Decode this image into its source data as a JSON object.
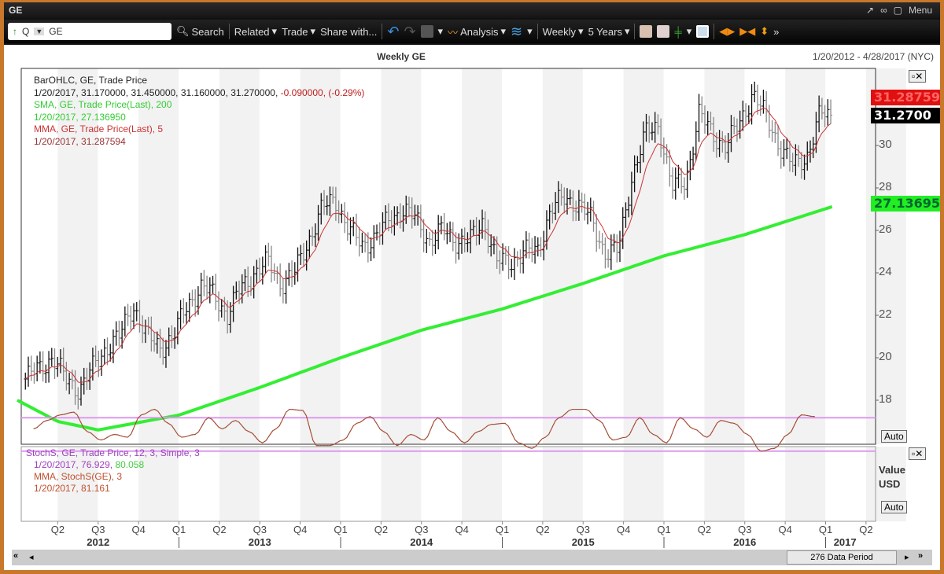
{
  "window": {
    "title": "GE",
    "menu_label": "Menu"
  },
  "toolbar": {
    "symbol_prefix": "Q",
    "symbol": "GE",
    "search": "Search",
    "related": "Related",
    "trade": "Trade",
    "share": "Share with...",
    "analysis": "Analysis",
    "period": "Weekly",
    "range": "5 Years"
  },
  "chart": {
    "title": "Weekly GE",
    "date_range": "1/20/2012 - 4/28/2017 (NYC)",
    "legend": {
      "bar_title": "BarOHLC, GE, Trade Price",
      "bar_values": "1/20/2017, 31.170000, 31.450000, 31.160000, 31.270000,",
      "bar_change": "-0.090000, (-0.29%)",
      "sma_title": "SMA, GE, Trade Price(Last),  200",
      "sma_value": "1/20/2017, 27.136950",
      "mma_title": "MMA, GE, Trade Price(Last),  5",
      "mma_value": "1/20/2017, 31.287594"
    },
    "tags": {
      "mma": "31.28759",
      "last": "31.2700",
      "sma": "27.13695"
    },
    "auto_label": "Auto",
    "stoch_legend": {
      "title": "StochS, GE, Trade Price,  12, 3, Simple, 3",
      "value_a": "1/20/2017, 76.929,",
      "value_b": "80.058",
      "mma_title": "MMA, StochS(GE),  3",
      "mma_value": "1/20/2017, 81.161"
    },
    "stoch_axis": {
      "line1": "Value",
      "line2": "USD"
    },
    "scroll": {
      "label": "276 Data Period"
    },
    "colors": {
      "sma": "#33ee33",
      "mma": "#cc3333",
      "stoch": "#cc66cc",
      "last_tag": "#000000",
      "mma_tag": "#e01010"
    }
  },
  "chart_data": {
    "type": "ohlc",
    "title": "Weekly GE",
    "ylim": [
      15.9,
      33.6
    ],
    "yticks": [
      18,
      20,
      22,
      24,
      26,
      28,
      30
    ],
    "xticks": [
      {
        "q": "Q2",
        "t": 2012.25
      },
      {
        "q": "Q3",
        "t": 2012.5
      },
      {
        "q": "Q4",
        "t": 2012.75
      },
      {
        "q": "Q1",
        "t": 2013.0
      },
      {
        "q": "Q2",
        "t": 2013.25
      },
      {
        "q": "Q3",
        "t": 2013.5
      },
      {
        "q": "Q4",
        "t": 2013.75
      },
      {
        "q": "Q1",
        "t": 2014.0
      },
      {
        "q": "Q2",
        "t": 2014.25
      },
      {
        "q": "Q3",
        "t": 2014.5
      },
      {
        "q": "Q4",
        "t": 2014.75
      },
      {
        "q": "Q1",
        "t": 2015.0
      },
      {
        "q": "Q2",
        "t": 2015.25
      },
      {
        "q": "Q3",
        "t": 2015.5
      },
      {
        "q": "Q4",
        "t": 2015.75
      },
      {
        "q": "Q1",
        "t": 2016.0
      },
      {
        "q": "Q2",
        "t": 2016.25
      },
      {
        "q": "Q3",
        "t": 2016.5
      },
      {
        "q": "Q4",
        "t": 2016.75
      },
      {
        "q": "Q1",
        "t": 2017.0
      },
      {
        "q": "Q2",
        "t": 2017.25
      }
    ],
    "years": [
      {
        "label": "2012",
        "t": 2012.5
      },
      {
        "label": "2013",
        "t": 2013.5
      },
      {
        "label": "2014",
        "t": 2014.5
      },
      {
        "label": "2015",
        "t": 2015.5
      },
      {
        "label": "2016",
        "t": 2016.5
      },
      {
        "label": "2017",
        "t": 2017.12
      }
    ],
    "monthly_close_start": 2012.05,
    "monthly_close": [
      19,
      19.5,
      20,
      19,
      18.5,
      19.5,
      20.5,
      21,
      22.5,
      21,
      20.5,
      21,
      22.5,
      23.3,
      23,
      22,
      23.3,
      24,
      24.5,
      23.5,
      24,
      25.5,
      27,
      27.5,
      26,
      25.3,
      25.7,
      26.5,
      27,
      26.5,
      25.5,
      26,
      25.5,
      25.5,
      26.5,
      24.5,
      24.5,
      25,
      25,
      27,
      27.5,
      27.3,
      26.5,
      25,
      25,
      28.5,
      30.5,
      31,
      28,
      28.3,
      31.5,
      30.5,
      30,
      31,
      32.5,
      31.3,
      30,
      29,
      29.5,
      31.5,
      31.3
    ],
    "sma200": [
      [
        2012.0,
        18
      ],
      [
        2012.25,
        17
      ],
      [
        2012.5,
        16.6
      ],
      [
        2013.0,
        17.3
      ],
      [
        2013.5,
        18.6
      ],
      [
        2014.0,
        20
      ],
      [
        2014.5,
        21.3
      ],
      [
        2015.0,
        22.3
      ],
      [
        2015.5,
        23.5
      ],
      [
        2016.0,
        24.8
      ],
      [
        2016.5,
        25.8
      ],
      [
        2017.05,
        27.14
      ]
    ],
    "stoch_monthly": [
      60,
      75,
      85,
      90,
      55,
      40,
      50,
      45,
      85,
      95,
      70,
      45,
      50,
      80,
      60,
      75,
      55,
      35,
      60,
      95,
      93,
      30,
      30,
      40,
      70,
      82,
      55,
      30,
      50,
      40,
      80,
      55,
      35,
      55,
      68,
      70,
      35,
      25,
      45,
      80,
      95,
      95,
      75,
      40,
      45,
      80,
      50,
      35,
      80,
      60,
      45,
      75,
      70,
      50,
      20,
      25,
      50,
      85,
      82
    ],
    "stoch_levels": [
      80,
      20
    ]
  }
}
